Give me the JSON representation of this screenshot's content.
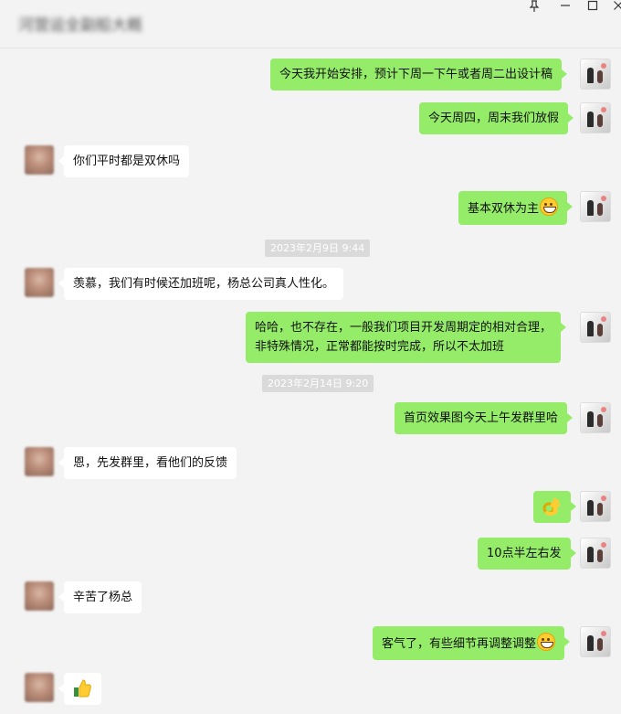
{
  "window": {
    "title": "河营运全副船大概",
    "pin_icon": "pin-icon",
    "minimize_icon": "minimize-icon",
    "maximize_icon": "maximize-icon",
    "close_icon": "close-icon"
  },
  "messages": [
    {
      "side": "self",
      "text": "今天我开始安排，预计下周一下午或者周二出设计稿"
    },
    {
      "side": "self",
      "text": "今天周四，周末我们放假"
    },
    {
      "side": "other",
      "text": "你们平时都是双休吗"
    },
    {
      "side": "self",
      "text": "基本双休为主",
      "emoji": "grin-emoji"
    },
    {
      "side": "time",
      "text": "2023年2月9日 9:44"
    },
    {
      "side": "other",
      "text": "羡慕，我们有时候还加班呢，杨总公司真人性化。"
    },
    {
      "side": "self",
      "lines": [
        "哈哈，也不存在，一般我们项目开发周期定的相对合理，",
        "非特殊情况，正常都能按时完成，所以不太加班"
      ]
    },
    {
      "side": "time",
      "text": "2023年2月14日 9:20"
    },
    {
      "side": "self",
      "text": "首页效果图今天上午发群里哈"
    },
    {
      "side": "other",
      "text": "恩，先发群里，看他们的反馈"
    },
    {
      "side": "self",
      "emoji": "ok-hand-emoji"
    },
    {
      "side": "self",
      "text": "10点半左右发"
    },
    {
      "side": "other",
      "text": "辛苦了杨总"
    },
    {
      "side": "self",
      "text": "客气了，有些细节再调整调整",
      "emoji": "grin-emoji"
    },
    {
      "side": "other",
      "emoji": "thumbs-up-emoji"
    }
  ]
}
